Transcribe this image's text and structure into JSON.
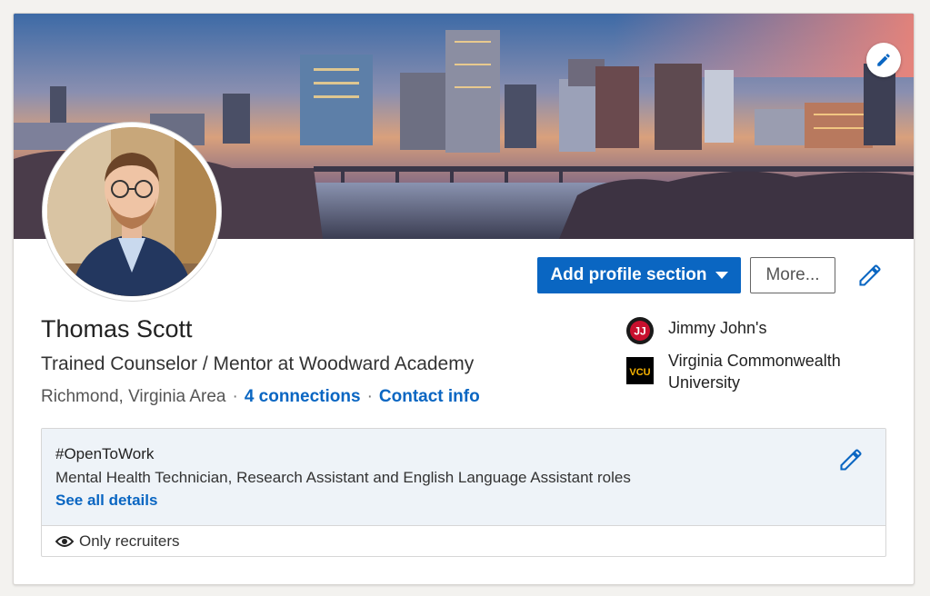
{
  "profile": {
    "name": "Thomas Scott",
    "headline": "Trained Counselor / Mentor at Woodward Academy",
    "location": "Richmond, Virginia Area",
    "connections_label": "4 connections",
    "contact_info_label": "Contact info",
    "separator": "·"
  },
  "actions": {
    "add_profile_section": "Add profile section",
    "more": "More..."
  },
  "experience_summary": [
    {
      "name": "Jimmy John's",
      "logo_text": "JJ",
      "icon": "jimmy-johns-logo"
    },
    {
      "name_line1": "Virginia Commonwealth",
      "name_line2": "University",
      "logo_text": "VCU",
      "icon": "vcu-logo"
    }
  ],
  "open_to_work": {
    "title": "#OpenToWork",
    "roles": "Mental Health Technician, Research Assistant and English Language Assistant roles",
    "see_all": "See all details",
    "visibility": "Only recruiters"
  },
  "colors": {
    "accent": "#0a66c2",
    "open_box_bg": "#eef3f8",
    "vcu_gold": "#f8b300"
  }
}
